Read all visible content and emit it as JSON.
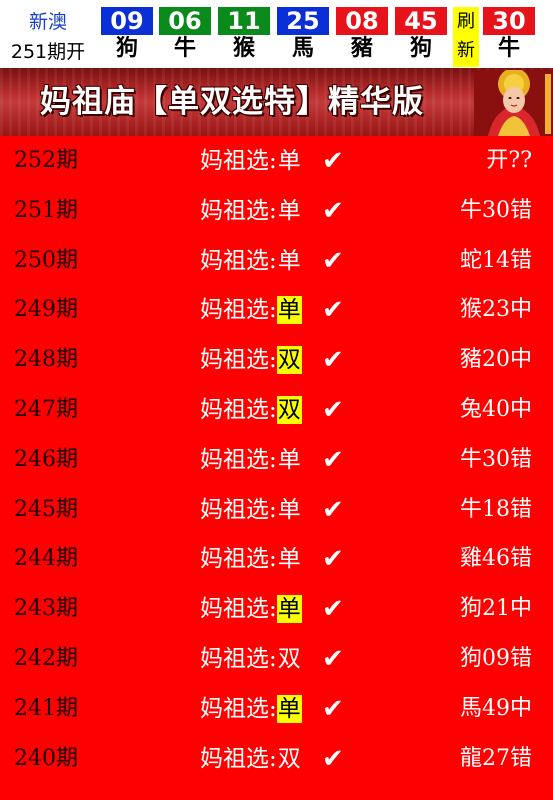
{
  "topbar": {
    "brand_name": "新澳",
    "issue": "251期开",
    "balls": [
      {
        "num": "09",
        "zodiac": "狗",
        "color": "#0b2fd6"
      },
      {
        "num": "06",
        "zodiac": "牛",
        "color": "#0a8a1a"
      },
      {
        "num": "11",
        "zodiac": "猴",
        "color": "#0a8a1a"
      },
      {
        "num": "25",
        "zodiac": "馬",
        "color": "#0b2fd6"
      },
      {
        "num": "08",
        "zodiac": "豬",
        "color": "#e8121b"
      },
      {
        "num": "45",
        "zodiac": "狗",
        "color": "#e8121b"
      },
      {
        "num": "30",
        "zodiac": "牛",
        "color": "#e8121b"
      }
    ],
    "refresh_top": "刷",
    "refresh_bottom": "新"
  },
  "banner": {
    "title": "妈祖庙【单双选特】精华版",
    "image": "mazu-deity-icon"
  },
  "pick_label": "妈祖选:",
  "check_mark": "✔",
  "rows": [
    {
      "period": "252期",
      "pick": "单",
      "highlight": false,
      "result": "开??"
    },
    {
      "period": "251期",
      "pick": "单",
      "highlight": false,
      "result": "牛30错"
    },
    {
      "period": "250期",
      "pick": "单",
      "highlight": false,
      "result": "蛇14错"
    },
    {
      "period": "249期",
      "pick": "单",
      "highlight": true,
      "result": "猴23中"
    },
    {
      "period": "248期",
      "pick": "双",
      "highlight": true,
      "result": "豬20中"
    },
    {
      "period": "247期",
      "pick": "双",
      "highlight": true,
      "result": "兔40中"
    },
    {
      "period": "246期",
      "pick": "单",
      "highlight": false,
      "result": "牛30错"
    },
    {
      "period": "245期",
      "pick": "单",
      "highlight": false,
      "result": "牛18错"
    },
    {
      "period": "244期",
      "pick": "单",
      "highlight": false,
      "result": "雞46错"
    },
    {
      "period": "243期",
      "pick": "单",
      "highlight": true,
      "result": "狗21中"
    },
    {
      "period": "242期",
      "pick": "双",
      "highlight": false,
      "result": "狗09错"
    },
    {
      "period": "241期",
      "pick": "单",
      "highlight": true,
      "result": "馬49中"
    },
    {
      "period": "240期",
      "pick": "双",
      "highlight": false,
      "result": "龍27错"
    }
  ],
  "colors": {
    "page_bg": "#ff0000",
    "highlight": "#ffff00",
    "blue_ball": "#0b2fd6",
    "green_ball": "#0a8a1a",
    "red_ball": "#e8121b"
  }
}
